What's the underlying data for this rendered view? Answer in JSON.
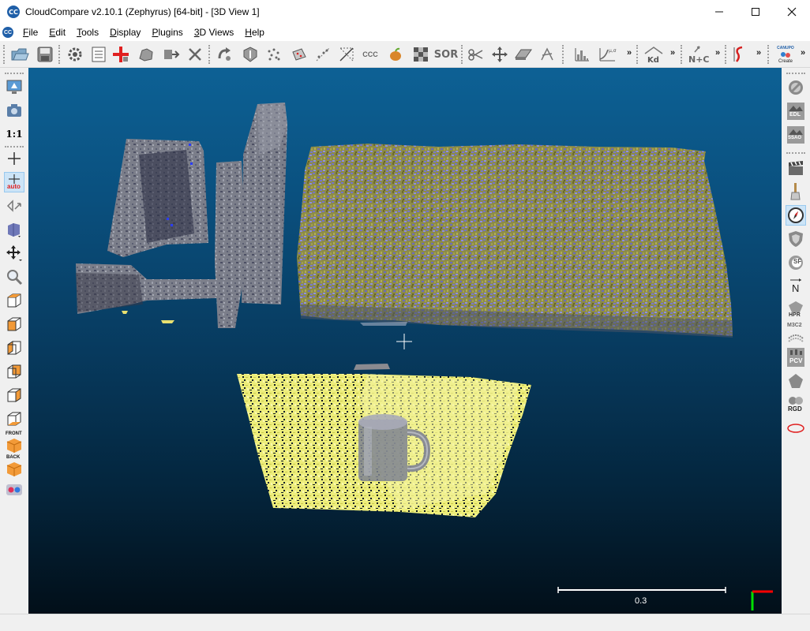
{
  "window": {
    "title": "CloudCompare v2.10.1 (Zephyrus) [64-bit] - [3D View 1]",
    "logo_text": "CC"
  },
  "menu": {
    "items": [
      {
        "label": "File",
        "u": "F",
        "rest": "ile"
      },
      {
        "label": "Edit",
        "u": "E",
        "rest": "dit"
      },
      {
        "label": "Tools",
        "u": "T",
        "rest": "ools"
      },
      {
        "label": "Display",
        "u": "D",
        "rest": "isplay"
      },
      {
        "label": "Plugins",
        "u": "P",
        "rest": "lugins"
      },
      {
        "label": "3D Views",
        "u": "3",
        "rest": "D Views"
      },
      {
        "label": "Help",
        "u": "H",
        "rest": "elp"
      }
    ]
  },
  "toolbar": {
    "labels": {
      "ccc": "CCC",
      "sor": "SOR",
      "kd": "Kd",
      "nc": "N+C",
      "canupo": "CANUPO",
      "create": "Create"
    },
    "more_glyph": "»",
    "icons": [
      "open-icon",
      "save-icon",
      "settings-icon",
      "properties-icon",
      "merge-icon",
      "subsample-icon",
      "segment-icon",
      "delete-icon",
      "register-icon",
      "fine-register-icon",
      "random-points-icon",
      "sample-mesh-icon",
      "scatter-icon",
      "bounding-box-icon",
      "ccc-icon",
      "mango-icon",
      "checker-icon",
      "sor-icon",
      "scissors-icon",
      "translate-icon",
      "plane-icon",
      "compass-icon",
      "histogram-icon",
      "graph-icon",
      "kd-tree-icon",
      "normals-icon",
      "script-icon",
      "canupo-icon"
    ]
  },
  "left_toolbar": {
    "labels": {
      "one_to_one": "1:1",
      "auto": "auto",
      "front": "FRONT",
      "back": "BACK"
    }
  },
  "right_toolbar": {
    "labels": {
      "edl": "EDL",
      "ssao": "SSAO",
      "sf": "SF",
      "n": "N",
      "hpr": "HPR",
      "m3c2": "M3C2",
      "pcv": "PCV",
      "rgd": "RGD"
    }
  },
  "view": {
    "scale_label": "0.3",
    "colors": {
      "accent": "#1f5fa8",
      "selection": "#cce4f7",
      "axis_x": "#ff0000",
      "axis_y": "#00ff00",
      "scale_bar": "#ffffff"
    }
  }
}
